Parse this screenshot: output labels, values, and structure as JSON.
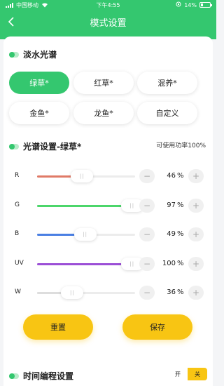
{
  "statusbar": {
    "carrier": "中国移动",
    "time": "下午4:55",
    "battery": "14%"
  },
  "header": {
    "title": "模式设置"
  },
  "modes": {
    "title": "淡水光谱",
    "items": [
      {
        "label": "绿草*",
        "active": true
      },
      {
        "label": "红草*",
        "active": false
      },
      {
        "label": "混养*",
        "active": false
      },
      {
        "label": "金鱼*",
        "active": false
      },
      {
        "label": "龙鱼*",
        "active": false
      },
      {
        "label": "自定义",
        "active": false
      }
    ]
  },
  "spectrum": {
    "title": "光谱设置-绿草*",
    "power_note": "可使用功率100%",
    "channels": [
      {
        "label": "R",
        "value": "46",
        "unit": "%",
        "level": 0.46,
        "color": "#e07a67"
      },
      {
        "label": "G",
        "value": "97",
        "unit": "%",
        "level": 0.97,
        "color": "#4cd66b"
      },
      {
        "label": "B",
        "value": "49",
        "unit": "%",
        "level": 0.49,
        "color": "#4a7fe3"
      },
      {
        "label": "UV",
        "value": "100",
        "unit": "%",
        "level": 1.0,
        "color": "#9b4fd6"
      },
      {
        "label": "W",
        "value": "36",
        "unit": "%",
        "level": 0.36,
        "color": "#dddddd"
      }
    ],
    "minus": "−",
    "plus": "+"
  },
  "actions": {
    "reset": "重置",
    "save": "保存"
  },
  "schedule": {
    "title": "时间编程设置",
    "on": "开",
    "off": "关"
  },
  "colors": {
    "accent": "#34c76f",
    "button": "#f8c513"
  }
}
